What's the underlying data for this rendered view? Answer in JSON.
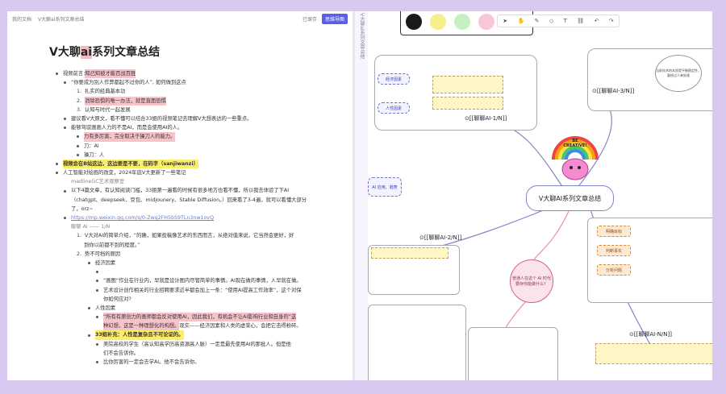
{
  "doc": {
    "breadcrumb": [
      "我的文档",
      "V大聊ai系列文章总结"
    ],
    "save_status": "已保存",
    "mindmap_button": "思维导图",
    "title_prefix": "V大聊",
    "title_highlight": "ai",
    "title_suffix": "系列文章总结",
    "lines": [
      {
        "level": 0,
        "bullet": "dot",
        "parts": [
          {
            "t": "视频前言: "
          },
          {
            "t": "知己知彼才能百战百胜",
            "s": "pink"
          }
        ]
      },
      {
        "level": 1,
        "bullet": "dot",
        "parts": [
          {
            "t": "“你要成为别人作弊都起不过你的人”, 如何做到这点"
          }
        ]
      },
      {
        "level": 2,
        "bullet": "num",
        "num": "1.",
        "parts": [
          {
            "t": "扎实的经典基本功"
          }
        ]
      },
      {
        "level": 2,
        "bullet": "num",
        "num": "2.",
        "parts": [
          {
            "t": "消除恐惧的唯一办法，就是直面恐惧",
            "s": "pink"
          }
        ]
      },
      {
        "level": 2,
        "bullet": "num",
        "num": "3.",
        "parts": [
          {
            "t": "认知与时代一起发展"
          }
        ]
      },
      {
        "level": 1,
        "bullet": "dot",
        "parts": [
          {
            "t": "建议看V大原文，看不懂可以结合33姐的视频笔记去理解V大想表达的一些重点。"
          }
        ]
      },
      {
        "level": 1,
        "bullet": "dot",
        "parts": [
          {
            "t": "能够驾驭画画人力的不是AI，而是会使用AI的人。"
          }
        ]
      },
      {
        "level": 2,
        "bullet": "dot",
        "parts": [
          {
            "t": "力有多厉害，完全取决于操刀人的能力。",
            "s": "pink"
          }
        ]
      },
      {
        "level": 2,
        "bullet": "dot",
        "parts": [
          {
            "t": "刀：AI"
          }
        ]
      },
      {
        "level": 2,
        "bullet": "dot",
        "parts": [
          {
            "t": "操刀：人"
          }
        ]
      },
      {
        "level": 0,
        "bullet": "dot",
        "parts": [
          {
            "t": "视频会在B站这边，这边要是不要，在码字（sanjiwanzi）",
            "s": "yellow"
          }
        ]
      },
      {
        "level": 0,
        "bullet": "dot",
        "parts": [
          {
            "t": "人工智能对绘画的改变，2024年底V大更新了一些笔记"
          }
        ]
      },
      {
        "level": 1,
        "bullet": "none",
        "parts": [
          {
            "t": "madlineGC艺术观察室",
            "s": "muted"
          }
        ]
      },
      {
        "level": 1,
        "bullet": "dot",
        "parts": [
          {
            "t": "以下4篇文章，有认知阅读门槛，33姐第一遍看的时候有很多地方也看不懂，所以我去体验了下AI"
          }
        ]
      },
      {
        "level": 1,
        "bullet": "none",
        "parts": [
          {
            "t": "（chatgpt、deepseek、豆包、midjounery、Stable Diffusion。）回来看了3-4遍，就可以看懂大部分"
          }
        ]
      },
      {
        "level": 1,
        "bullet": "none",
        "parts": [
          {
            "t": "了，orz~"
          }
        ]
      },
      {
        "level": 1,
        "bullet": "dot",
        "parts": [
          {
            "t": "https://mp.weixin.qq.com/s/0-Zwq2FH5bS9TLn3nw1ovQ",
            "s": "link"
          }
        ]
      },
      {
        "level": 1,
        "bullet": "none",
        "parts": [
          {
            "t": "聊聊 AI —— 1/N",
            "s": "muted"
          }
        ]
      },
      {
        "level": 2,
        "bullet": "num",
        "num": "1.",
        "parts": [
          {
            "t": "V大对AI的简单介绍，“的确，如果投稿像艺术的东西而言，从绝对值来说，它当然会更好，好"
          }
        ]
      },
      {
        "level": 2,
        "bullet": "none",
        "parts": [
          {
            "t": "到你以前都不到的程度。”"
          }
        ]
      },
      {
        "level": 2,
        "bullet": "num",
        "num": "2.",
        "parts": [
          {
            "t": "势不可挡的原因"
          }
        ]
      },
      {
        "level": 3,
        "bullet": "dot",
        "parts": [
          {
            "t": "经济因素"
          }
        ]
      },
      {
        "level": 4,
        "bullet": "dot",
        "parts": [
          {
            "t": ""
          }
        ]
      },
      {
        "level": 4,
        "bullet": "dot",
        "parts": [
          {
            "t": "“画图”作业在行业内，早就是设计图内尽管简单的事情。AI现在做的事情，人早就在做。"
          }
        ]
      },
      {
        "level": 4,
        "bullet": "dot",
        "parts": [
          {
            "t": "艺术设计创作相关的行业招聘要求近半都会加上一条：“使用AI提高工作效率”，这个对保"
          }
        ]
      },
      {
        "level": 4,
        "bullet": "none",
        "parts": [
          {
            "t": "你如何应对?"
          }
        ]
      },
      {
        "level": 3,
        "bullet": "dot",
        "parts": [
          {
            "t": "人性因素"
          }
        ]
      },
      {
        "level": 4,
        "bullet": "dot",
        "parts": [
          {
            "t": "“所有有原创力的画师都会反对使用AI，因此我们，有机会不让AI影响行业和自身的”这",
            "s": "pinkred"
          }
        ]
      },
      {
        "level": 4,
        "bullet": "none",
        "parts": [
          {
            "t": "种幻想，这是一种理想化的构想。",
            "s": "pinkred"
          },
          {
            "t": "现实——经济因素和人类的虚荣心，会把它击得粉碎。"
          }
        ]
      },
      {
        "level": 3,
        "bullet": "dot",
        "parts": [
          {
            "t": "33姐补充：人性是复杂且不可论证的。",
            "s": "yellow"
          }
        ]
      },
      {
        "level": 4,
        "bullet": "dot",
        "parts": [
          {
            "t": "美院高校的学生（高认知高学历高资源高人脉）一定是最先使用AI的那批人。但是他"
          }
        ]
      },
      {
        "level": 4,
        "bullet": "none",
        "parts": [
          {
            "t": "们不会告诉你。"
          }
        ]
      },
      {
        "level": 4,
        "bullet": "dot",
        "parts": [
          {
            "t": "比你厉害的一定会去学AI。他不会告诉你。"
          }
        ]
      }
    ]
  },
  "strip": {
    "vertical_title": "V大聊ai系列文章总结"
  },
  "map": {
    "toolbar_icons": [
      "cursor-icon",
      "hand-icon",
      "pen-icon",
      "shape-icon",
      "text-icon",
      "link-icon",
      "undo-icon",
      "redo-icon"
    ],
    "swatch_colors": [
      "#1a1a1a",
      "#f6f08c",
      "#c7f0c2",
      "#f8c6d6"
    ],
    "center": "V大聊AI系列文章总结",
    "badge_text": [
      "BE",
      "CREATIVE!"
    ],
    "nodes": {
      "n1": "[[聊聊AI-1/N]]",
      "n2": "[[聊聊AI-2/N]]",
      "n3": "[[聊聊AI-3/N]]",
      "n4": "[[聊聊AI-N/N]]"
    },
    "tags_top": [
      "经济因素",
      "人性因素"
    ],
    "tag_left": "AI 应用、趋势",
    "tags_right": [
      "明确目标",
      "判断事实",
      "分析问题"
    ],
    "pink_question": "普通人在这个 AI 时代要存你能做什么？",
    "bubble_top": "当前技术的本质是平衡稳定性，要经过人来处理"
  }
}
